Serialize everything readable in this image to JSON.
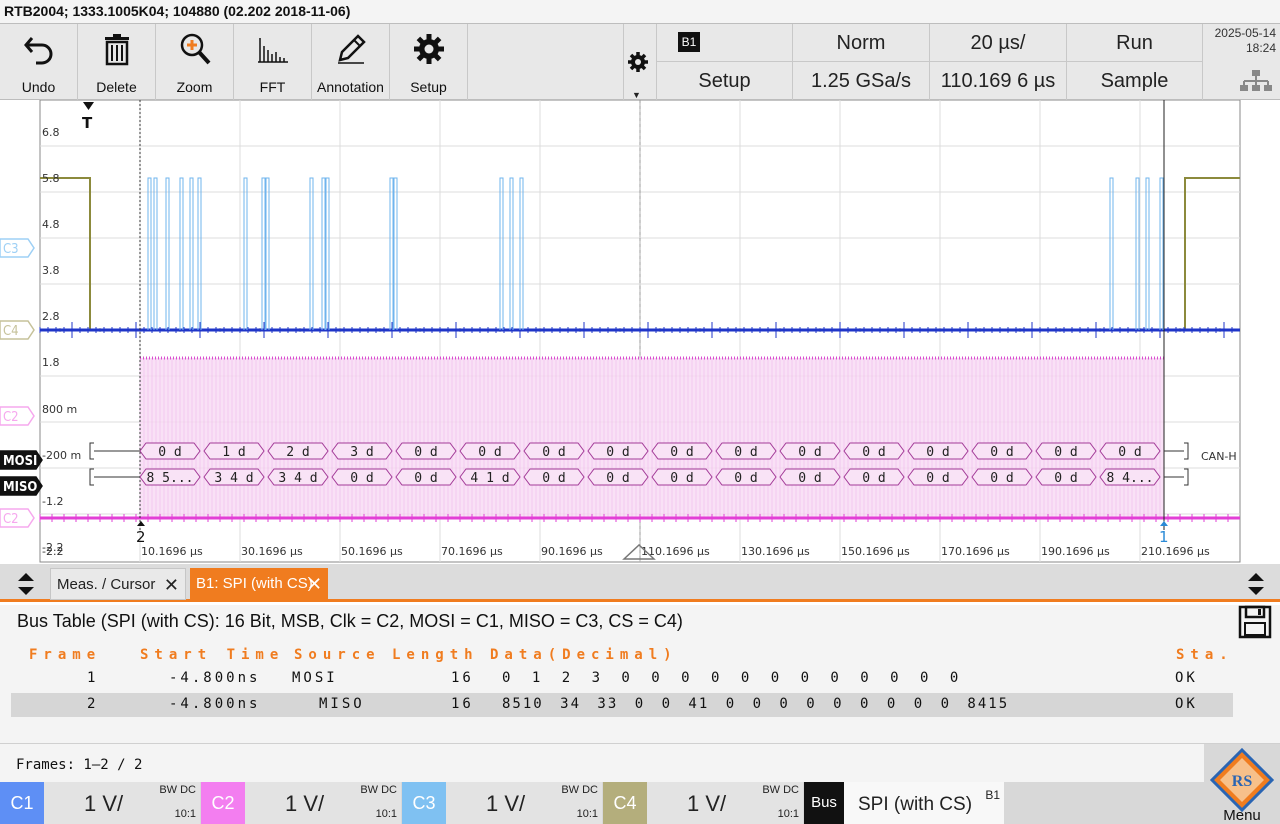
{
  "titlebar": {
    "text": "RTB2004; 1333.1005K04; 104880 (02.202 2018-11-06)"
  },
  "toolbar": {
    "tools": [
      {
        "id": "undo",
        "label": "Undo",
        "icon": "undo-arrow-icon"
      },
      {
        "id": "delete",
        "label": "Delete",
        "icon": "trash-icon"
      },
      {
        "id": "zoom",
        "label": "Zoom",
        "icon": "magnifier-plus-icon"
      },
      {
        "id": "fft",
        "label": "FFT",
        "icon": "spectrum-bars-icon"
      },
      {
        "id": "annotation",
        "label": "Annotation",
        "icon": "pencil-icon"
      },
      {
        "id": "setup",
        "label": "Setup",
        "icon": "gear-icon"
      }
    ],
    "trigger_source_badge": "B1",
    "trigger_setup_label": "Setup",
    "trigger_mode": "Norm",
    "sample_rate": "1.25 GSa/s",
    "timebase": "20 µs/",
    "horizontal_position": "110.169 6 µs",
    "run_state": "Run",
    "acquire_mode": "Sample",
    "date": "2025-05-14",
    "time": "18:24"
  },
  "scope": {
    "y_labels": [
      "6.8",
      "5.8",
      "4.8",
      "3.8",
      "2.8",
      "1.8",
      "800 m",
      "-200 m",
      "-1.2",
      "-2.2"
    ],
    "x_labels": [
      "10.1696 µs",
      "30.1696 µs",
      "50.1696 µs",
      "70.1696 µs",
      "90.1696 µs",
      "110.1696 µs",
      "130.1696 µs",
      "150.1696 µs",
      "170.1696 µs",
      "190.1696 µs",
      "210.1696 µs"
    ],
    "channel_markers": [
      {
        "label": "C3",
        "color": "#9ed0f5"
      },
      {
        "label": "C4",
        "color": "#c6c29a"
      },
      {
        "label": "C2",
        "color": "#f6a8ee"
      },
      {
        "label": "MOSI",
        "color": "#111111"
      },
      {
        "label": "MISO",
        "color": "#111111"
      },
      {
        "label": "C2",
        "color": "#f6a8ee"
      }
    ],
    "trigger_marker": "T",
    "cursor_2_label": "2",
    "cursor_1_label": "1",
    "bus_end_label": "CAN-H",
    "mosi_frames": [
      "0 d",
      "1 d",
      "2 d",
      "3 d",
      "0 d",
      "0 d",
      "0 d",
      "0 d",
      "0 d",
      "0 d",
      "0 d",
      "0 d",
      "0 d",
      "0 d",
      "0 d",
      "0 d"
    ],
    "miso_frames": [
      "8 5...",
      "3 4 d",
      "3 4 d",
      "0 d",
      "0 d",
      "4 1 d",
      "0 d",
      "0 d",
      "0 d",
      "0 d",
      "0 d",
      "0 d",
      "0 d",
      "0 d",
      "0 d",
      "8 4..."
    ]
  },
  "tabs": {
    "meas_label": "Meas. / Cursor",
    "bus_label": "B1: SPI (with CS)",
    "close_glyph": "✕"
  },
  "bustable": {
    "title": "Bus Table (SPI (with CS): 16 Bit, MSB, Clk = C2, MOSI = C1, MISO = C3, CS = C4)",
    "headers": {
      "frame": "Frame",
      "start_time": "Start Time",
      "source": "Source",
      "length": "Length",
      "data": "Data(Decimal)",
      "status": "Sta."
    },
    "rows": [
      {
        "frame": "1",
        "start": "-4.800ns",
        "source": "MOSI",
        "length": "16",
        "data": "0 1 2 3 0 0 0 0 0 0 0 0 0 0 0 0",
        "status": "OK"
      },
      {
        "frame": "2",
        "start": "-4.800ns",
        "source": "MISO",
        "length": "16",
        "data": "8510 34 33 0 0 41 0 0 0 0 0 0 0 0 0 8415",
        "status": "OK"
      }
    ],
    "footer": "Frames: 1–2 / 2"
  },
  "channels": [
    {
      "name": "C1",
      "color": "#5e8ff5",
      "scale": "1 V/",
      "bw": "BW DC",
      "ratio": "10:1"
    },
    {
      "name": "C2",
      "color": "#f37ef0",
      "scale": "1 V/",
      "bw": "BW DC",
      "ratio": "10:1"
    },
    {
      "name": "C3",
      "color": "#7fc1f2",
      "scale": "1 V/",
      "bw": "BW DC",
      "ratio": "10:1"
    },
    {
      "name": "C4",
      "color": "#b4ae7c",
      "scale": "1 V/",
      "bw": "BW DC",
      "ratio": "10:1"
    }
  ],
  "bus": {
    "badge": "Bus",
    "name": "SPI (with CS)",
    "tag": "B1"
  },
  "menu": {
    "label": "Menu",
    "logo_text": "RS"
  }
}
